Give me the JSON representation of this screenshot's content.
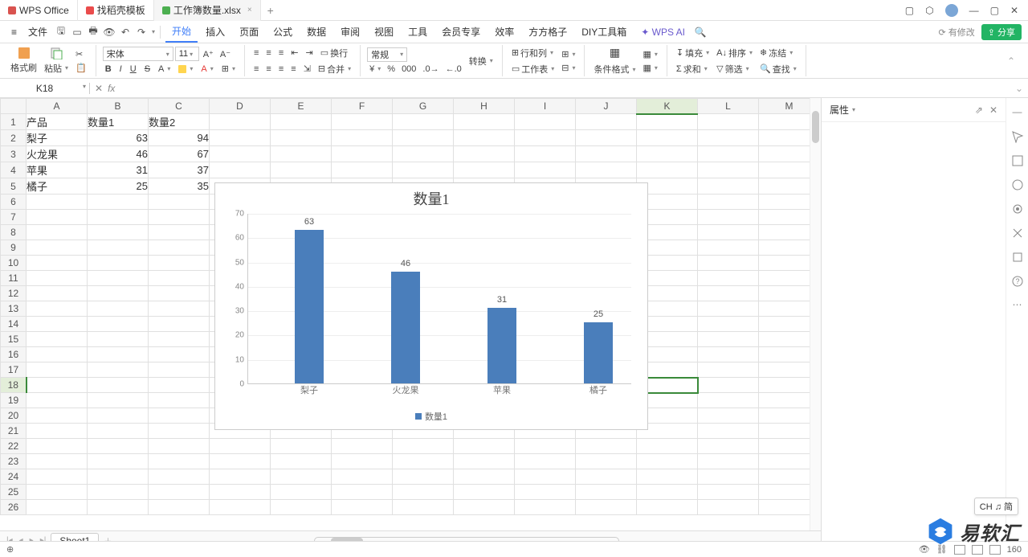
{
  "titlebar": {
    "tabs": [
      {
        "label": "WPS Office",
        "icon": "wps"
      },
      {
        "label": "找稻壳模板",
        "icon": "doc"
      },
      {
        "label": "工作簿数量.xlsx",
        "icon": "xls",
        "active": true
      }
    ],
    "add": "+"
  },
  "menu": {
    "hamburger": "≡",
    "file": "文件",
    "tabs": [
      "开始",
      "插入",
      "页面",
      "公式",
      "数据",
      "审阅",
      "视图",
      "工具",
      "会员专享",
      "效率",
      "方方格子",
      "DIY工具箱"
    ],
    "ai": "WPS AI",
    "save_notice": "有修改",
    "share": "分享"
  },
  "ribbon": {
    "brush": "格式刷",
    "paste": "粘贴",
    "font": "宋体",
    "size": "11",
    "boldset": [
      "B",
      "I",
      "U",
      "S",
      "A"
    ],
    "wrap": "换行",
    "merge": "合并",
    "fmt": "常规",
    "convert": "转换",
    "rowcol": "行和列",
    "sheet": "工作表",
    "cond": "条件格式",
    "fill": "填充",
    "sort": "排序",
    "sum": "求和",
    "filter": "筛选",
    "freeze": "冻结",
    "find": "查找"
  },
  "namebox": "K18",
  "sidepanel": {
    "title": "属性"
  },
  "columns": [
    "A",
    "B",
    "C",
    "D",
    "E",
    "F",
    "G",
    "H",
    "I",
    "J",
    "K",
    "L",
    "M"
  ],
  "data_headers": [
    "产品",
    "数量1",
    "数量2"
  ],
  "table_data": [
    [
      "梨子",
      63,
      94
    ],
    [
      "火龙果",
      46,
      67
    ],
    [
      "苹果",
      31,
      37
    ],
    [
      "橘子",
      25,
      35
    ]
  ],
  "chart_data": {
    "type": "bar",
    "title": "数量1",
    "categories": [
      "梨子",
      "火龙果",
      "苹果",
      "橘子"
    ],
    "values": [
      63,
      46,
      31,
      25
    ],
    "ylim": [
      0,
      70
    ],
    "ytick_step": 10,
    "legend": "数量1",
    "color": "#4a7ebb"
  },
  "sheettab": "Sheet1",
  "ime": "CH ♫ 简",
  "zoom": "160",
  "watermark": "易软汇"
}
